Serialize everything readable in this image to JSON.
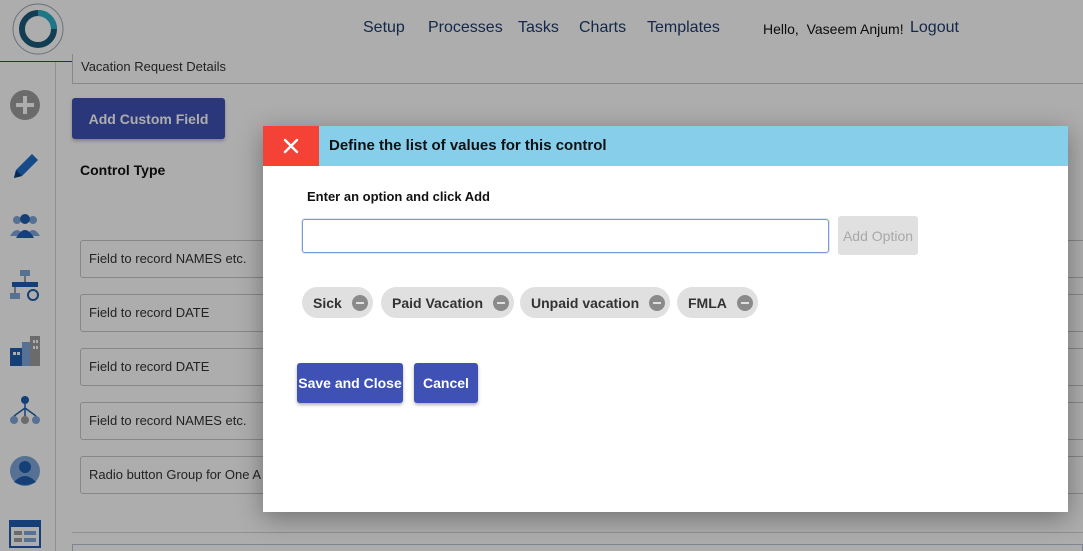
{
  "header": {
    "nav": [
      "Setup",
      "Processes",
      "Tasks",
      "Charts",
      "Templates"
    ],
    "greeting": "Hello,  Vaseem Anjum!",
    "logout": "Logout"
  },
  "sidebar": {
    "icons": [
      "add-circle-icon",
      "pencil-icon",
      "users-icon",
      "workflow-icon",
      "buildings-icon",
      "hierarchy-icon",
      "user-avatar-icon",
      "form-icon"
    ]
  },
  "main": {
    "title_value": "Vacation Request Details",
    "add_custom_field": "Add Custom Field",
    "control_type_label": "Control Type",
    "field_rows": [
      "Field to record NAMES etc.",
      "Field to record DATE",
      "Field to record DATE",
      "Field to record NAMES etc.",
      "Radio button Group for One A"
    ]
  },
  "modal": {
    "title": "Define the list of values for this control",
    "prompt": "Enter an option and click Add",
    "input_value": "",
    "add_option": "Add Option",
    "options": [
      "Sick",
      "Paid Vacation",
      "Unpaid vacation",
      "FMLA"
    ],
    "save_close": "Save and Close",
    "cancel": "Cancel"
  },
  "colors": {
    "primary": "#3f51b5",
    "modal_header": "#87ceeb",
    "close": "#f44336",
    "nav_text": "#1f3b6e"
  }
}
